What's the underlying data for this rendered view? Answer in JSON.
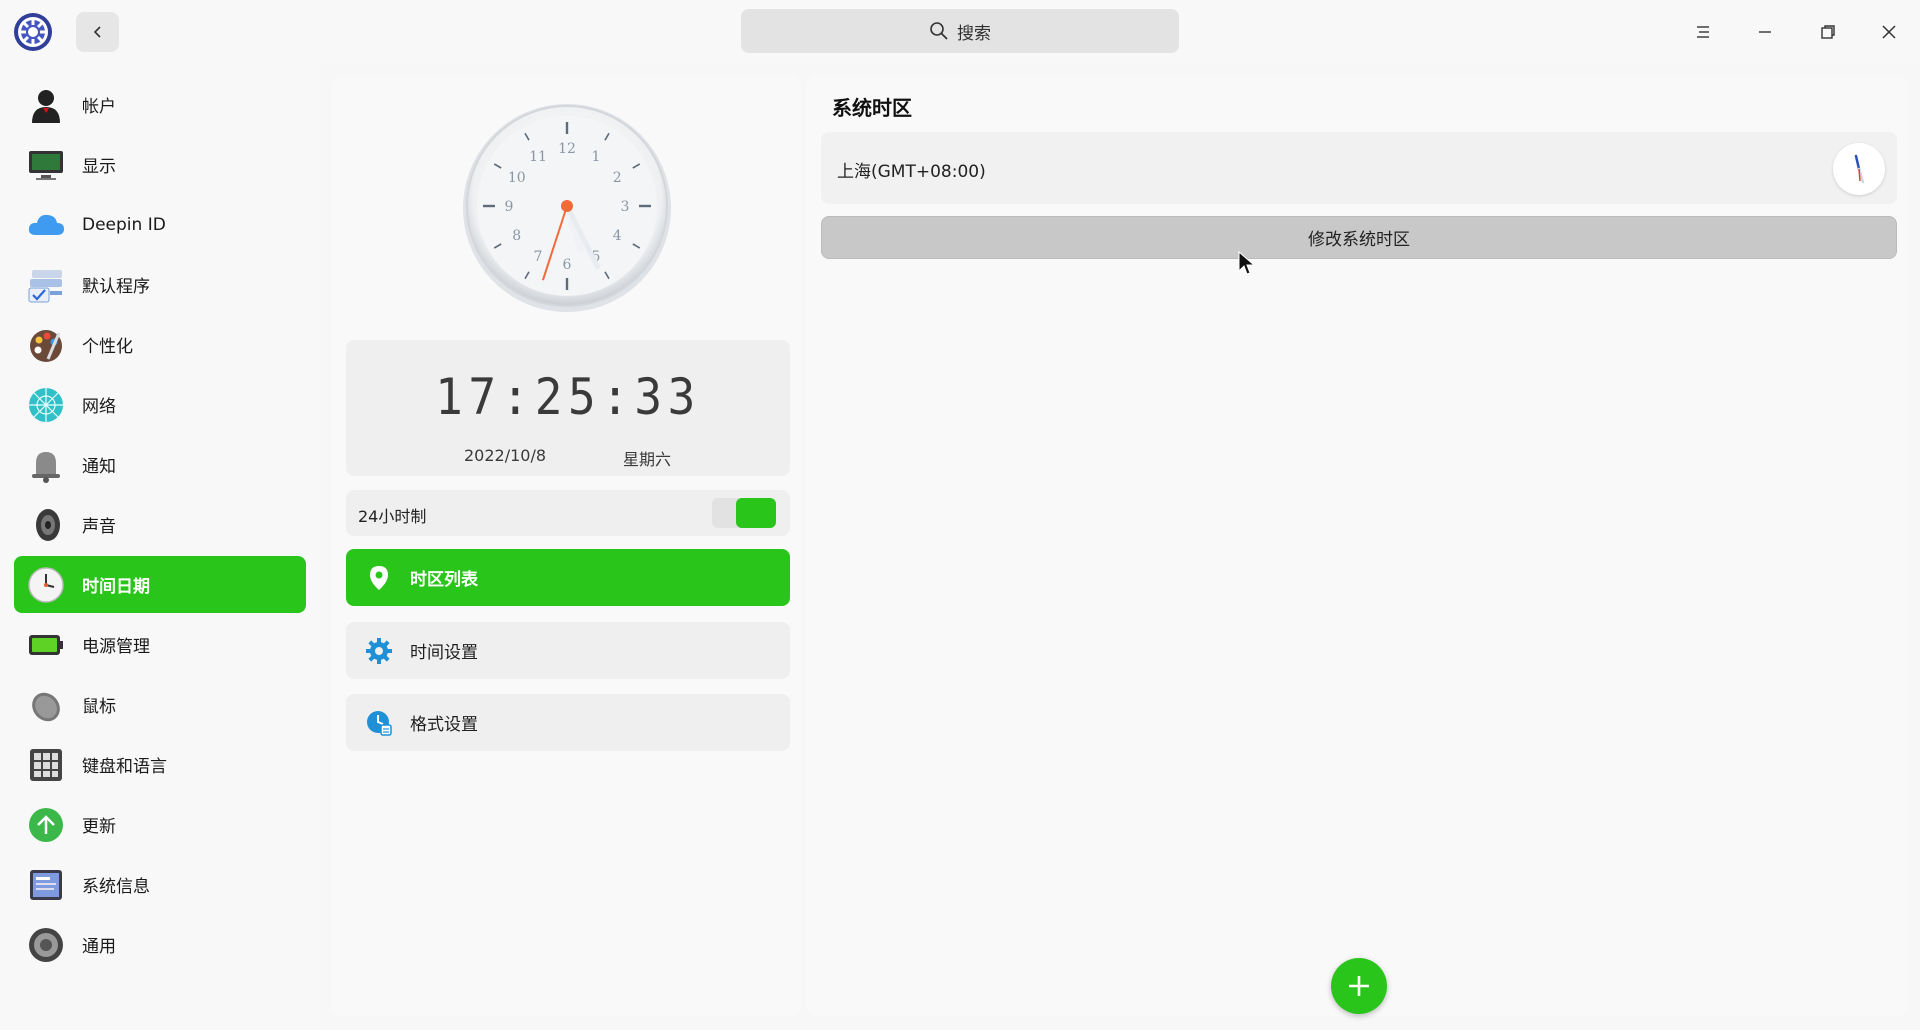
{
  "search": {
    "label": "搜索"
  },
  "sidebar": {
    "items": [
      {
        "label": "帐户",
        "icon": "account-icon"
      },
      {
        "label": "显示",
        "icon": "display-icon"
      },
      {
        "label": "Deepin ID",
        "icon": "cloud-icon"
      },
      {
        "label": "默认程序",
        "icon": "default-apps-icon"
      },
      {
        "label": "个性化",
        "icon": "palette-icon"
      },
      {
        "label": "网络",
        "icon": "network-icon"
      },
      {
        "label": "通知",
        "icon": "bell-icon"
      },
      {
        "label": "声音",
        "icon": "speaker-icon"
      },
      {
        "label": "时间日期",
        "icon": "clock-icon",
        "active": true
      },
      {
        "label": "电源管理",
        "icon": "battery-icon"
      },
      {
        "label": "鼠标",
        "icon": "mouse-icon"
      },
      {
        "label": "键盘和语言",
        "icon": "keyboard-icon"
      },
      {
        "label": "更新",
        "icon": "update-icon"
      },
      {
        "label": "系统信息",
        "icon": "system-info-icon"
      },
      {
        "label": "通用",
        "icon": "general-icon"
      }
    ]
  },
  "clock": {
    "digital": "17:25:33",
    "date": "2022/10/8",
    "weekday": "星期六",
    "hour": 17,
    "minute": 25,
    "second": 33
  },
  "format24": {
    "label": "24小时制",
    "enabled": true
  },
  "menu": {
    "timezone_list": "时区列表",
    "time_settings": "时间设置",
    "format_settings": "格式设置"
  },
  "right": {
    "title": "系统时区",
    "timezone": "上海(GMT+08:00)",
    "change_button": "修改系统时区"
  },
  "colors": {
    "accent": "#2ac51a"
  }
}
